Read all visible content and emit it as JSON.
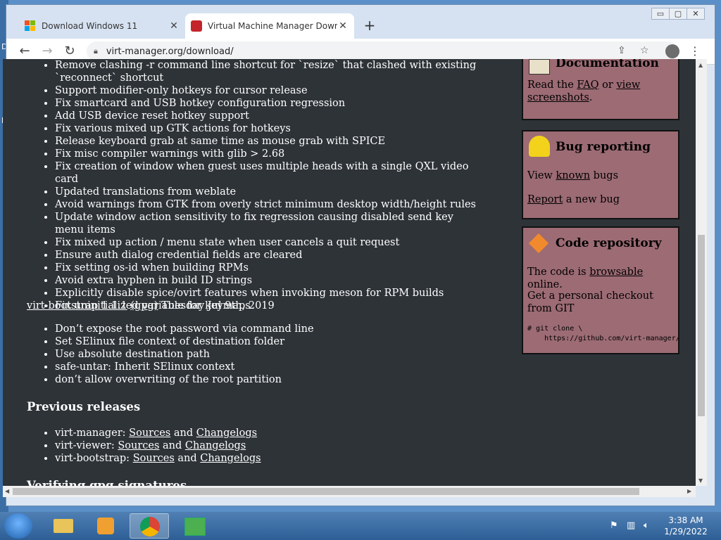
{
  "desktop": {
    "side_text_1": "D",
    "side_text_2": "D"
  },
  "browser": {
    "tabs": [
      {
        "label": "Download Windows 11",
        "icon": "microsoft-logo-icon",
        "active": false
      },
      {
        "label": "Virtual Machine Manager Downl",
        "icon": "virt-manager-favicon-icon",
        "active": true
      }
    ],
    "new_tab_label": "+",
    "window_controls": {
      "minimize": "▭",
      "maximize": "▢",
      "close": "✕"
    },
    "address": "virt-manager.org/download/",
    "nav": {
      "back": "←",
      "forward": "→",
      "reload": "↻"
    }
  },
  "page": {
    "bullets_top": [
      "Remove clashing -r command line shortcut for `resize` that clashed with existing `reconnect` shortcut",
      "Support modifier-only hotkeys for cursor release",
      "Fix smartcard and USB hotkey configuration regression",
      "Add USB device reset hotkey support",
      "Fix various mixed up GTK actions for hotkeys",
      "Release keyboard grab at same time as mouse grab with SPICE",
      "Fix misc compiler warnings with glib > 2.68",
      "Fix creation of window when guest uses multiple heads with a single QXL video card",
      "Updated translations from weblate",
      "Avoid warnings from GTK from overly strict minimum desktop width/height rules",
      "Update window action sensitivity to fix regression causing disabled send key menu items",
      "Fix mixed up action / menu state when user cancels a quit request",
      "Ensure auth dialog credential fields are cleared",
      "Fix setting os-id when building RPMs",
      "Avoid extra hyphen in build ID strings",
      "Explicitly disable spice/ovirt features when invoking meson for RPM builds",
      "Fix uninitialized variable for keymaps"
    ],
    "release": {
      "link": "virt-bootstrap 1.1.1",
      "gpg": "(gpg)",
      "date": " Tuesday Jul 9th, 2019"
    },
    "bullets_release": [
      "Don’t expose the root password via command line",
      "Set SElinux file context of destination folder",
      "Use absolute destination path",
      "safe-untar: Inherit SElinux context",
      "don’t allow overwriting of the root partition"
    ],
    "previous_heading": "Previous releases",
    "previous": [
      {
        "name": "virt-manager: ",
        "sources": "Sources",
        "and": " and ",
        "changelogs": "Changelogs"
      },
      {
        "name": "virt-viewer: ",
        "sources": "Sources",
        "and": " and ",
        "changelogs": "Changelogs"
      },
      {
        "name": "virt-bootstrap: ",
        "sources": "Sources",
        "and": " and ",
        "changelogs": "Changelogs"
      }
    ],
    "verify_heading": "Verifying gpg signatures"
  },
  "sidebar": {
    "documentation": {
      "title": "Documentation",
      "read_the": "Read the ",
      "faq": "FAQ",
      "or": " or ",
      "view_screenshots": "view screenshots",
      "period": "."
    },
    "bugs": {
      "title": "Bug reporting",
      "view": "View ",
      "known": "known",
      "bugs": " bugs",
      "report": "Report",
      "new_bug": " a new bug"
    },
    "code": {
      "title": "Code repository",
      "code_is": "The code is ",
      "browsable": "browsable",
      "online": " online.",
      "checkout": "Get a personal checkout from GIT",
      "git": "# git clone \\\n    https://github.com/virt-manager/virt"
    }
  },
  "taskbar": {
    "time": "3:38 AM",
    "date": "1/29/2022"
  },
  "colors": {
    "page_bg": "#2e3338",
    "sidebar_box": "#9c6b74"
  }
}
